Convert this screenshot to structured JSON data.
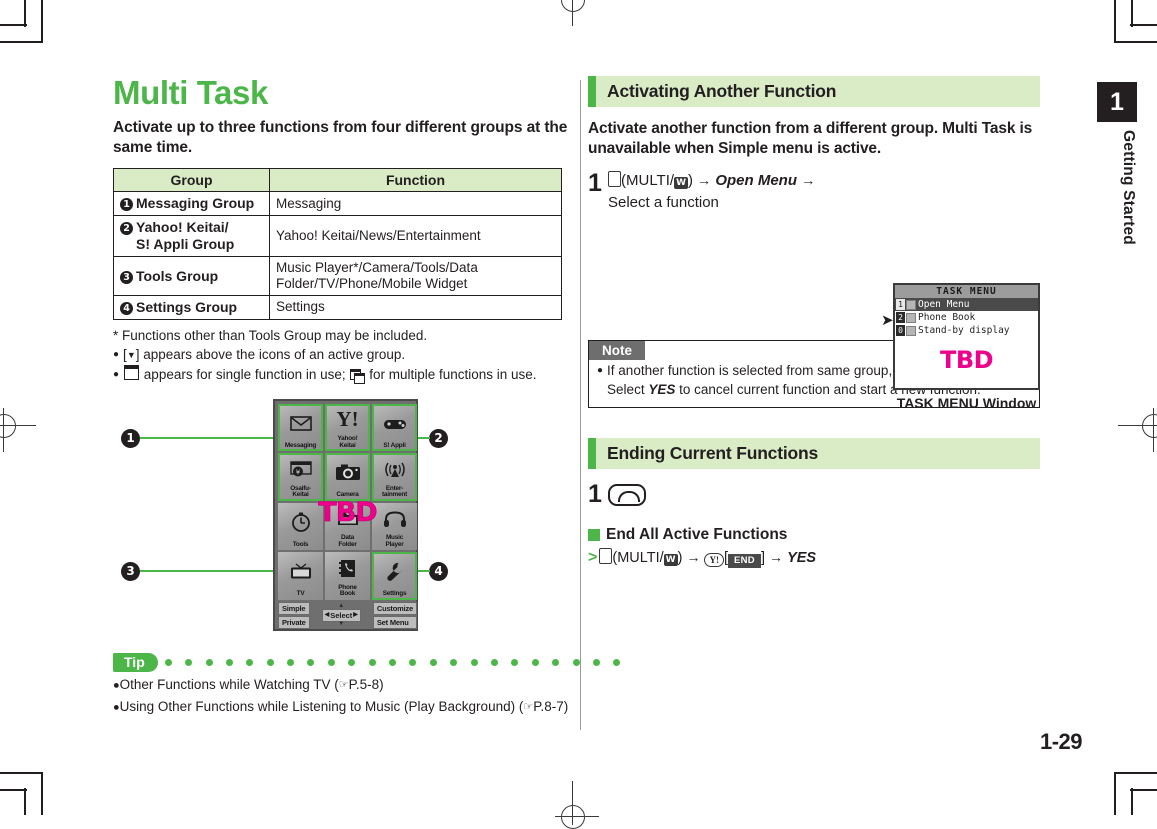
{
  "document": {
    "main_title": "Multi Task",
    "lead": "Activate up to three functions from four different groups at the same time.",
    "page_number": "1-29",
    "chapter_number": "1",
    "chapter_title": "Getting Started"
  },
  "table": {
    "headers": [
      "Group",
      "Function"
    ],
    "rows": [
      {
        "num": "❶",
        "group": "Messaging Group",
        "function": "Messaging"
      },
      {
        "num": "❷",
        "group": "Yahoo! Keitai/\nS! Appli Group",
        "function": "Yahoo! Keitai/News/Entertainment"
      },
      {
        "num": "❸",
        "group": "Tools Group",
        "function": "Music Player*/Camera/Tools/Data Folder/TV/Phone/Mobile Widget"
      },
      {
        "num": "❹",
        "group": "Settings Group",
        "function": "Settings"
      }
    ]
  },
  "notes_left": {
    "footnote": "* Functions other than Tools Group may be included.",
    "bullet1_pre": "[",
    "bullet1_glyph": "▼",
    "bullet1_post": "] appears above the icons of an active group.",
    "bullet2_pre": "",
    "bullet2_mid": " appears for single function in use; ",
    "bullet2_post": " for multiple functions in use."
  },
  "figure": {
    "tbd_label": "TBD",
    "cells": [
      {
        "label": "Messaging",
        "glyph": "✉",
        "icon_name": "envelope-icon",
        "highlight": true
      },
      {
        "label": "Yahoo!\nKeitai",
        "glyph": "Y!",
        "icon_name": "yahoo-icon",
        "highlight": true
      },
      {
        "label": "S! Appli",
        "glyph": "🎮",
        "icon_name": "gamepad-icon",
        "highlight": true
      },
      {
        "label": "Osaifu-\nKeitai",
        "glyph": "¥",
        "icon_name": "wallet-icon",
        "highlight": true
      },
      {
        "label": "Camera",
        "glyph": "📷",
        "icon_name": "camera-icon",
        "highlight": true
      },
      {
        "label": "Enter-\ntainment",
        "glyph": "((•))",
        "icon_name": "antenna-icon",
        "highlight": true
      },
      {
        "label": "Tools",
        "glyph": "◴",
        "icon_name": "clock-icon",
        "highlight": false
      },
      {
        "label": "Data\nFolder",
        "glyph": "📁",
        "icon_name": "folder-icon",
        "highlight": false
      },
      {
        "label": "Music\nPlayer",
        "glyph": "Ω",
        "icon_name": "headphones-icon",
        "highlight": false
      },
      {
        "label": "TV",
        "glyph": "▣",
        "icon_name": "television-icon",
        "highlight": false
      },
      {
        "label": "Phone\nBook",
        "glyph": "☎",
        "icon_name": "phonebook-icon",
        "highlight": false
      },
      {
        "label": "Settings",
        "glyph": "🔧",
        "icon_name": "wrench-icon",
        "highlight": true
      }
    ],
    "soft_keys": {
      "left_top": "Simple",
      "left_bottom": "Private",
      "center": "Select",
      "right_top": "Customize",
      "right_bottom": "Set Menu"
    },
    "callouts": [
      "❶",
      "❷",
      "❸",
      "❹"
    ]
  },
  "tip": {
    "badge": "Tip",
    "lines": [
      {
        "text": "Other Functions while Watching TV (",
        "ref": "P.5-8",
        "close": ")"
      },
      {
        "text": "Using Other Functions while Listening to Music (Play Background) (",
        "ref": "P.8-7",
        "close": ")"
      }
    ]
  },
  "right": {
    "section1_title": "Activating Another Function",
    "section1_lead": "Activate another function from a different group. Multi Task is unavailable when Simple menu is active.",
    "step1_num": "1",
    "step1_key_label": "MULTI/",
    "step1_wkey": "W",
    "step1_open_menu": "Open Menu",
    "step1_select": "Select a function",
    "screenshot": {
      "title": "TASK MENU",
      "rows": [
        {
          "key": "1",
          "label": "Open Menu",
          "selected": true
        },
        {
          "key": "2",
          "label": "Phone Book",
          "selected": false
        },
        {
          "key": "0",
          "label": "Stand-by display",
          "selected": false
        }
      ],
      "tbd": "TBD",
      "caption": "TASK MENU Window"
    },
    "note": {
      "head": "Note",
      "line1": "If another function is selected from same group, confirmation appears.",
      "line2_pre": "Select ",
      "line2_yes": "YES",
      "line2_post": " to cancel current function and start a new function."
    },
    "section2_title": "Ending Current Functions",
    "step2_num": "1",
    "subhead": "End All Active Functions",
    "endall": {
      "gt": ">",
      "multi_label": "MULTI/",
      "wkey": "W",
      "ykey": "Y!",
      "endkey": "END",
      "yes": "YES"
    }
  },
  "colors": {
    "brand_green": "#4cb648",
    "light_green": "#d9ecc6",
    "magenta": "#ec008c",
    "ink": "#231f20"
  }
}
